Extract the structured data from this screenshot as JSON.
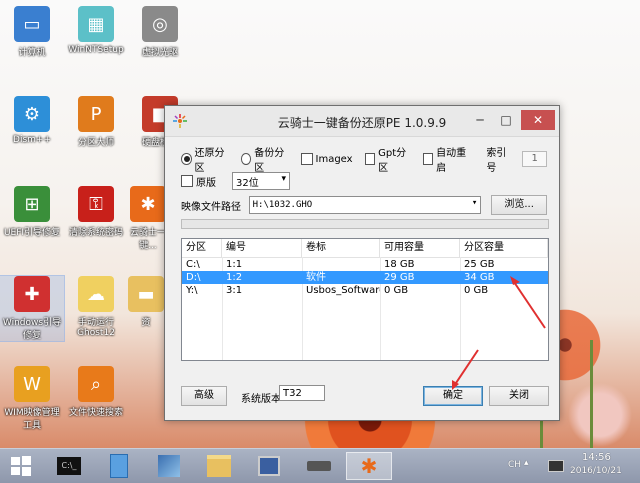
{
  "desktop": {
    "icons": [
      {
        "label": "计算机",
        "icon": "computer-icon",
        "color": "#3a7fd0"
      },
      {
        "label": "WinNTSetup",
        "icon": "winntsetup-icon",
        "color": "#5cc0c8"
      },
      {
        "label": "虚拟光驱",
        "icon": "virtual-drive-icon",
        "color": "#8a8a8a"
      },
      {
        "label": "Dism++",
        "icon": "gears-icon",
        "color": "#2d8fd8"
      },
      {
        "label": "分区大师",
        "icon": "partition-master-icon",
        "color": "#e07b1c"
      },
      {
        "label": "硬盘检测",
        "icon": "cube-icon",
        "color": "#c43b2a"
      },
      {
        "label": "UEFI引导修复",
        "icon": "uefi-repair-icon",
        "color": "#3a8f3a"
      },
      {
        "label": "清除系统密码",
        "icon": "password-key-icon",
        "color": "#c8201a"
      },
      {
        "label": "云骑士一键...",
        "icon": "yunqishi-icon",
        "color": "#e86a1a"
      },
      {
        "label": "Windows引导修复",
        "icon": "toolbox-icon",
        "color": "#d03030"
      },
      {
        "label": "手动运行Ghost12",
        "icon": "ghost-icon",
        "color": "#f0d060"
      },
      {
        "label": "资",
        "icon": "folder-icon",
        "color": "#e8c060"
      },
      {
        "label": "WIM映像管理工具",
        "icon": "wim-tool-icon",
        "color": "#e8a020"
      },
      {
        "label": "文件快速搜索",
        "icon": "magnifier-icon",
        "color": "#e87a1a"
      }
    ]
  },
  "dialog": {
    "title": "云骑士一键备份还原PE 1.0.9.9",
    "options": {
      "restore": "还原分区",
      "backup": "备份分区",
      "imagex": "Imagex",
      "gpt": "Gpt分区",
      "auto_reboot": "自动重启",
      "index_label": "索引号",
      "index_value": "1",
      "original": "原版",
      "bits": "32位"
    },
    "image_path_label": "映像文件路径",
    "image_path": "H:\\1032.GHO",
    "browse": "浏览...",
    "table": {
      "headers": [
        "分区",
        "编号",
        "卷标",
        "可用容量",
        "分区容量"
      ],
      "rows": [
        [
          "C:\\",
          "1:1",
          "",
          "18 GB",
          "25 GB"
        ],
        [
          "D:\\",
          "1:2",
          "软件",
          "29 GB",
          "34 GB"
        ],
        [
          "Y:\\",
          "3:1",
          "Usbos_Software",
          "0 GB",
          "0 GB"
        ]
      ],
      "selected_row": 1
    },
    "advanced": "高级",
    "sys_version_label": "系统版本",
    "sys_version": "T32",
    "ok": "确定",
    "close": "关闭"
  },
  "taskbar": {
    "items": [
      {
        "icon": "start-icon"
      },
      {
        "icon": "terminal-icon"
      },
      {
        "icon": "blank-app-icon"
      },
      {
        "icon": "disk-tool-icon"
      },
      {
        "icon": "file-explorer-icon"
      },
      {
        "icon": "screen-capture-icon"
      },
      {
        "icon": "hard-drive-icon"
      },
      {
        "icon": "yunqishi-icon"
      }
    ],
    "ime": "CH",
    "time": "14:56",
    "date": "2016/10/21"
  },
  "colors": {
    "selection": "#3399ff",
    "close_button": "#c75050",
    "annotation_arrow": "#e03030"
  }
}
